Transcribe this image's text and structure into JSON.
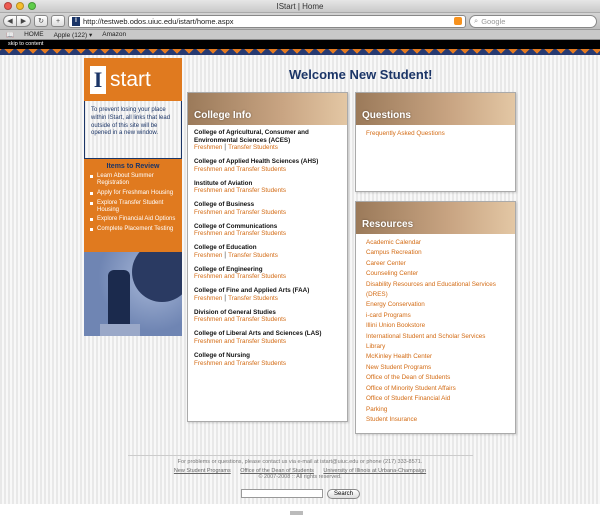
{
  "browser": {
    "window_title": "IStart | Home",
    "url": "http://testweb.odos.uiuc.edu/istart/home.aspx",
    "search_placeholder": "Google",
    "bookmarks": [
      "HOME",
      "Apple (122) ▾",
      "Amazon"
    ],
    "skip_link": "skip to content"
  },
  "logo": {
    "letter": "I",
    "word": "start"
  },
  "notice": "To prevent losing your place within IStart, all links that lead outside of this site will be opened in a new window.",
  "items_to_review": {
    "heading": "Items to Review",
    "items": [
      "Learn About Summer Registration",
      "Apply for Freshman Housing",
      "Explore Transfer Student Housing",
      "Explore Financial Aid Options",
      "Complete Placement Testing"
    ]
  },
  "headline": "Welcome New Student!",
  "college_info": {
    "heading": "College Info",
    "colleges": [
      {
        "name": "College of Agricultural, Consumer and Environmental Sciences (ACES)",
        "links": [
          "Freshmen",
          "Transfer Students"
        ]
      },
      {
        "name": "College of Applied Health Sciences (AHS)",
        "links": [
          "Freshmen and Transfer Students"
        ]
      },
      {
        "name": "Institute of Aviation",
        "links": [
          "Freshmen and Transfer Students"
        ]
      },
      {
        "name": "College of Business",
        "links": [
          "Freshmen and Transfer Students"
        ]
      },
      {
        "name": "College of Communications",
        "links": [
          "Freshmen and Transfer Students"
        ]
      },
      {
        "name": "College of Education",
        "links": [
          "Freshmen",
          "Transfer Students"
        ]
      },
      {
        "name": "College of Engineering",
        "links": [
          "Freshmen and Transfer Students"
        ]
      },
      {
        "name": "College of Fine and Applied Arts (FAA)",
        "links": [
          "Freshmen",
          "Transfer Students"
        ]
      },
      {
        "name": "Division of General Studies",
        "links": [
          "Freshmen and Transfer Students"
        ]
      },
      {
        "name": "College of Liberal Arts and Sciences (LAS)",
        "links": [
          "Freshmen and Transfer Students"
        ]
      },
      {
        "name": "College of Nursing",
        "links": [
          "Freshmen and Transfer Students"
        ]
      }
    ]
  },
  "questions": {
    "heading": "Questions",
    "links": [
      "Frequently Asked Questions"
    ]
  },
  "resources": {
    "heading": "Resources",
    "links": [
      "Academic Calendar",
      "Campus Recreation",
      "Career Center",
      "Counseling Center",
      "Disability Resources and Educational Services (DRES)",
      "Energy Conservation",
      "i-card Programs",
      "Illini Union Bookstore",
      "International Student and Scholar Services",
      "Library",
      "McKinley Health Center",
      "New Student Programs",
      "Office of the Dean of Students",
      "Office of Minority Student Affairs",
      "Office of Student Financial Aid",
      "Parking",
      "Student Insurance"
    ]
  },
  "footer": {
    "contact": "For problems or questions, please contact us via e-mail at istart@uiuc.edu or phone (217) 333-8571.",
    "links": [
      "New Student Programs",
      "Office of the Dean of Students",
      "University of Illinois at Urbana-Champaign"
    ],
    "copyright": "© 2007-2008 :: All rights reserved.",
    "search_button": "Search"
  },
  "colors": {
    "orange": "#e07a1f",
    "navy": "#1b3567",
    "link": "#d36b14"
  }
}
